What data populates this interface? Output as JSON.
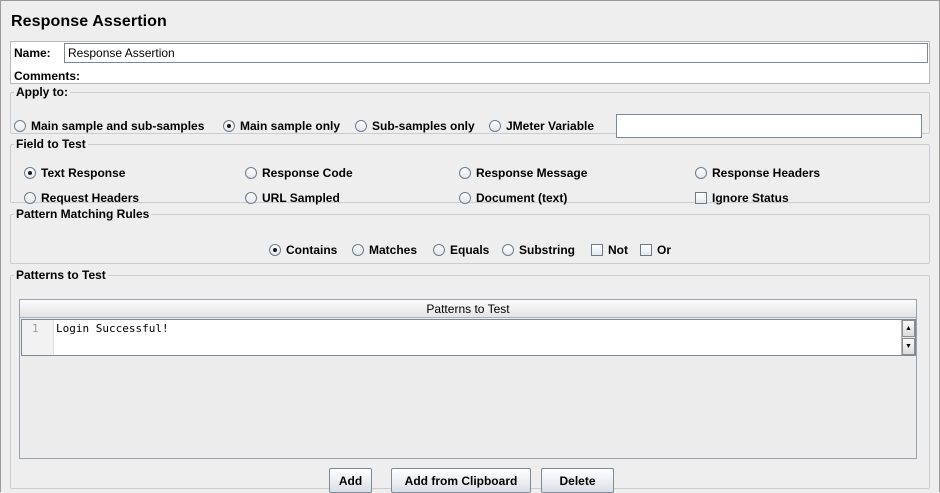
{
  "title": "Response Assertion",
  "name": {
    "label": "Name:",
    "value": "Response Assertion"
  },
  "comments": {
    "label": "Comments:",
    "value": ""
  },
  "apply_to": {
    "legend": "Apply to:",
    "options": [
      {
        "label": "Main sample and sub-samples",
        "selected": false
      },
      {
        "label": "Main sample only",
        "selected": true
      },
      {
        "label": "Sub-samples only",
        "selected": false
      },
      {
        "label": "JMeter Variable",
        "selected": false
      }
    ],
    "variable_value": ""
  },
  "field_to_test": {
    "legend": "Field to Test",
    "options": [
      {
        "label": "Text Response",
        "selected": true
      },
      {
        "label": "Response Code",
        "selected": false
      },
      {
        "label": "Response Message",
        "selected": false
      },
      {
        "label": "Response Headers",
        "selected": false
      },
      {
        "label": "Request Headers",
        "selected": false
      },
      {
        "label": "URL Sampled",
        "selected": false
      },
      {
        "label": "Document (text)",
        "selected": false
      }
    ],
    "ignore_status": {
      "label": "Ignore Status",
      "checked": false
    }
  },
  "pattern_rules": {
    "legend": "Pattern Matching Rules",
    "options": [
      {
        "label": "Contains",
        "selected": true
      },
      {
        "label": "Matches",
        "selected": false
      },
      {
        "label": "Equals",
        "selected": false
      },
      {
        "label": "Substring",
        "selected": false
      }
    ],
    "not": {
      "label": "Not",
      "checked": false
    },
    "or": {
      "label": "Or",
      "checked": false
    }
  },
  "patterns": {
    "legend": "Patterns to Test",
    "column_header": "Patterns to Test",
    "rows": [
      {
        "line": "1",
        "text": "Login Successful!"
      }
    ]
  },
  "buttons": {
    "add": "Add",
    "add_clipboard": "Add from Clipboard",
    "delete": "Delete"
  },
  "icons": {
    "scroll_up": "scroll-up-arrow-icon",
    "scroll_down": "scroll-down-arrow-icon"
  }
}
